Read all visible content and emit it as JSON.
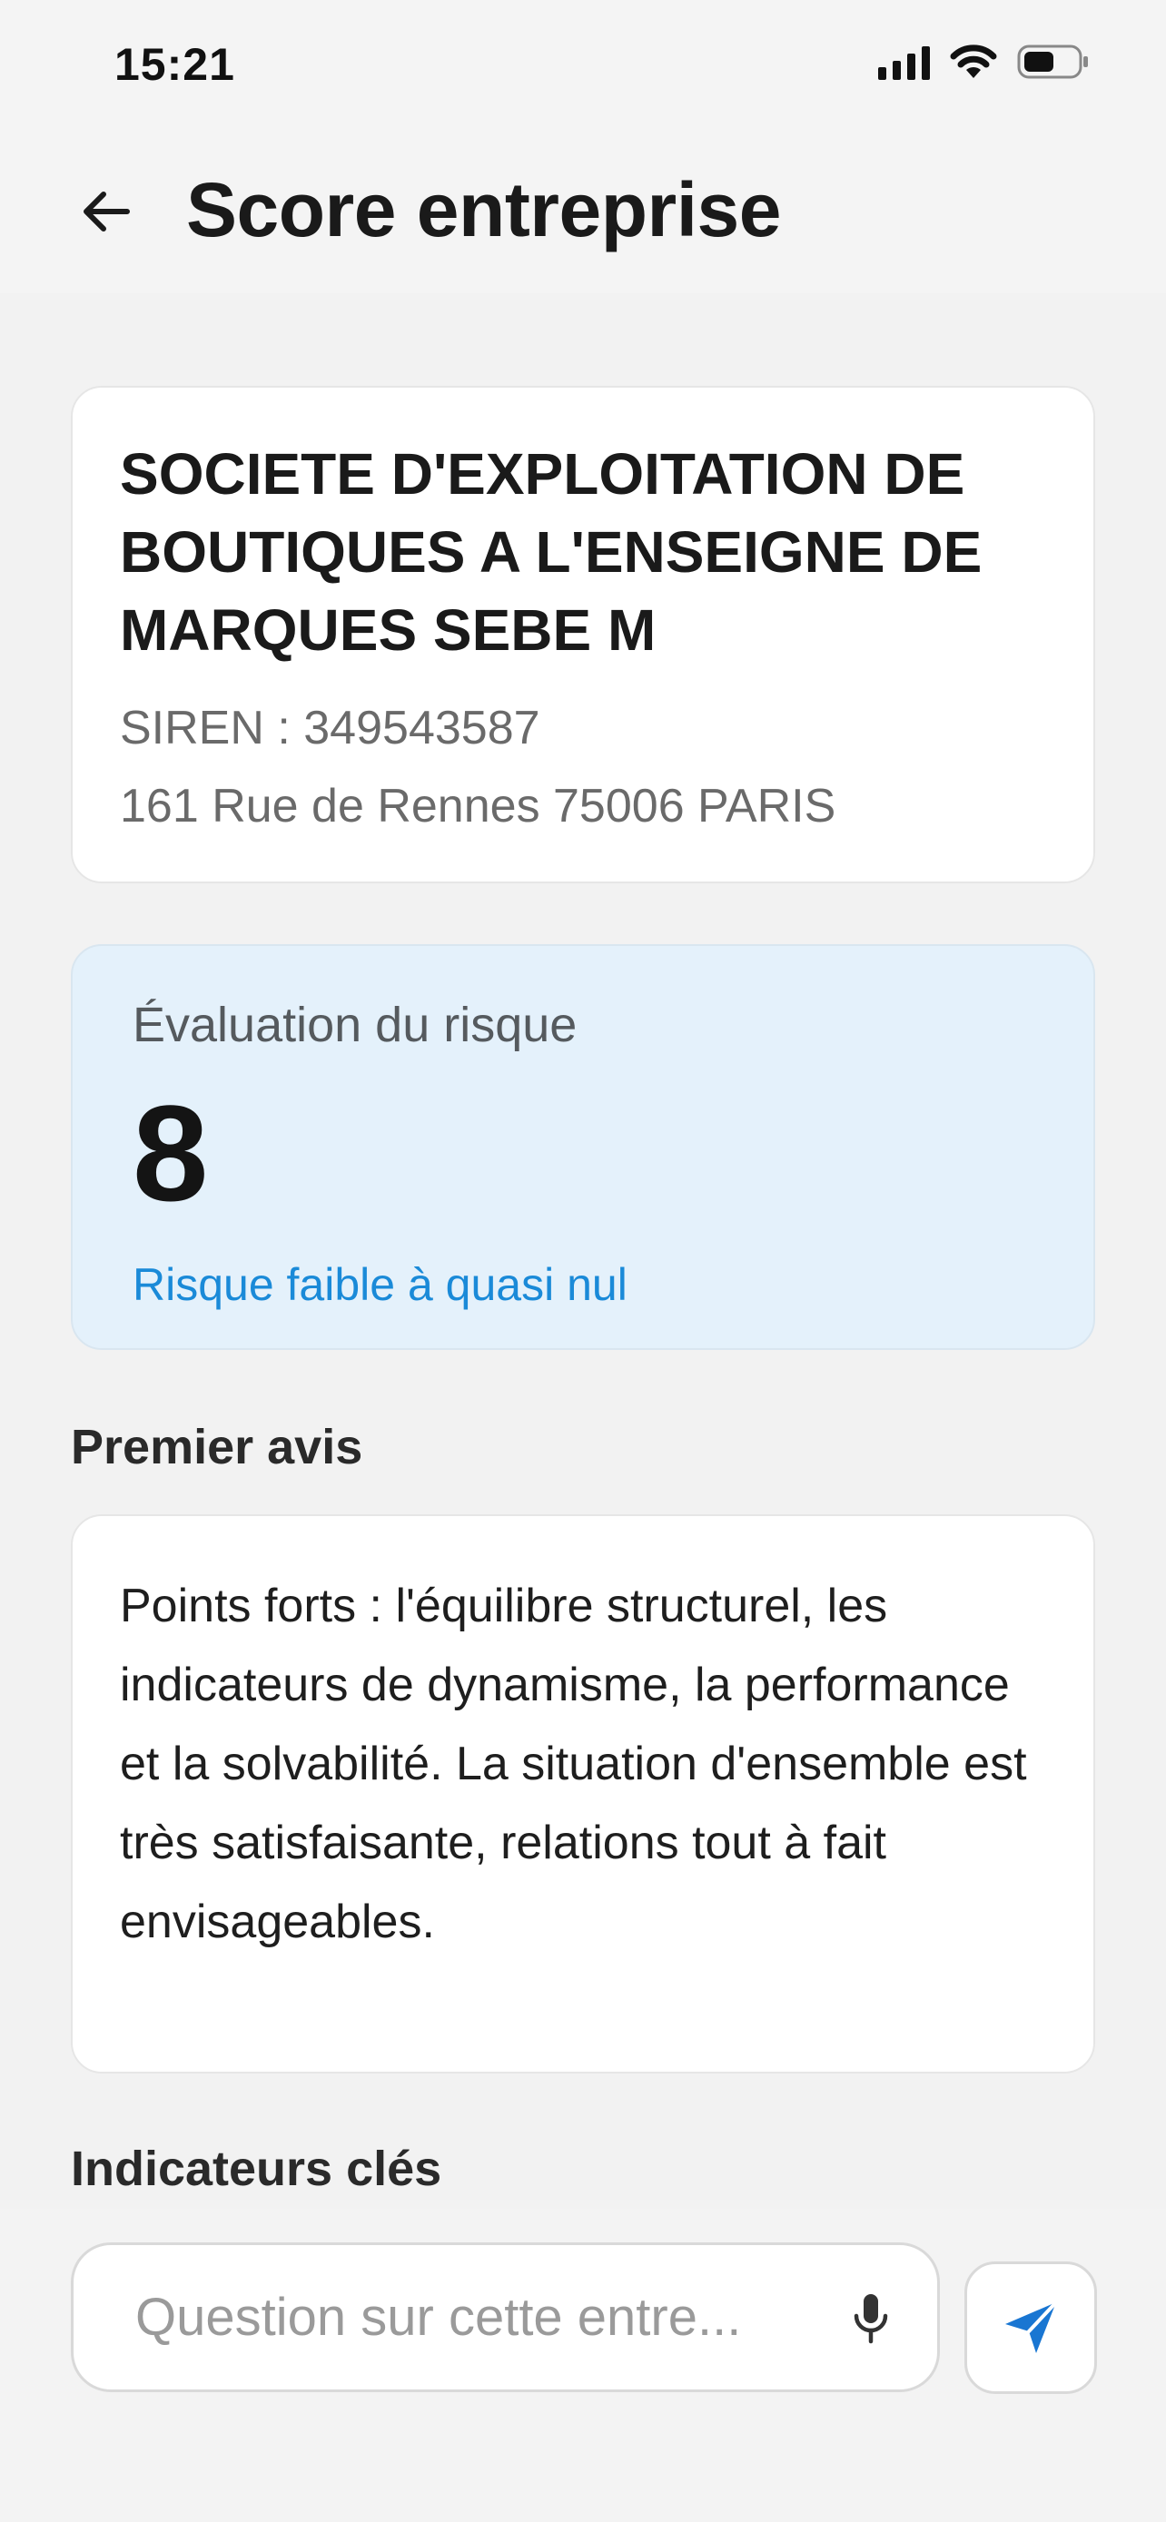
{
  "status_bar": {
    "time": "15:21"
  },
  "header": {
    "title": "Score entreprise"
  },
  "company": {
    "name": "SOCIETE D'EXPLOITATION DE BOUTIQUES A L'ENSEIGNE DE MARQUES SEBE M",
    "siren": "SIREN : 349543587",
    "address": "161 Rue de Rennes 75006 PARIS"
  },
  "risk": {
    "label": "Évaluation du risque",
    "score": "8",
    "description": "Risque faible à quasi nul",
    "accent_color": "#1a8ad8",
    "background_color": "#e4f1fb"
  },
  "premier_avis": {
    "title": "Premier avis",
    "text": "Points forts : l'équilibre structurel, les indicateurs de dynamisme, la performance et la solvabilité. La situation d'ensemble est très satisfaisante, relations tout à fait envisageables."
  },
  "indicateurs": {
    "title": "Indicateurs clés"
  },
  "chat": {
    "placeholder": "Question sur cette entre...",
    "send_icon": "send-icon",
    "mic_icon": "microphone-icon",
    "send_color": "#1976d2"
  }
}
